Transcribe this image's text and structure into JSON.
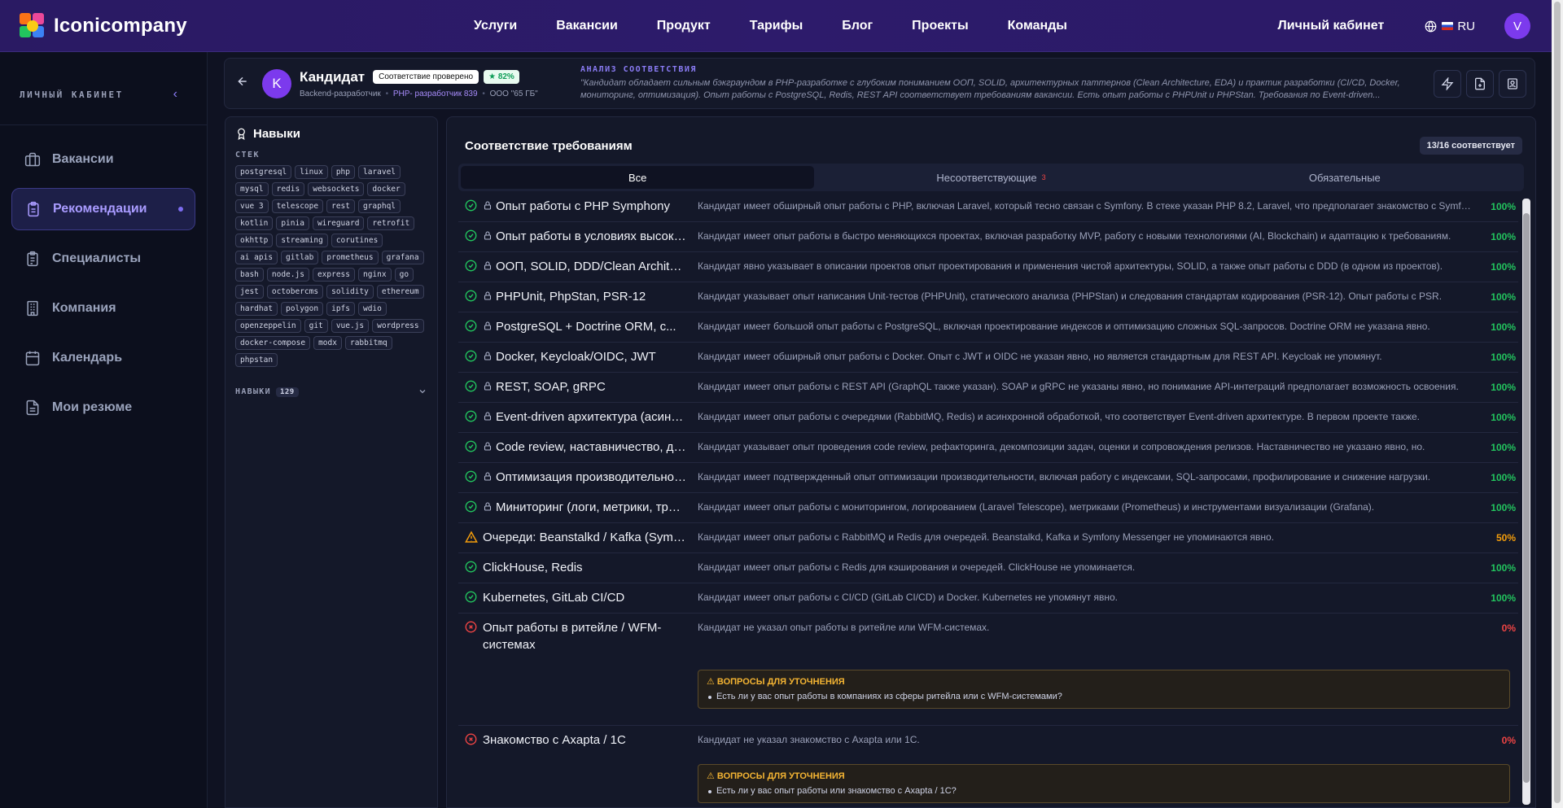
{
  "brand": {
    "name": "Iconicompany"
  },
  "nav": [
    "Услуги",
    "Вакансии",
    "Продукт",
    "Тарифы",
    "Блог",
    "Проекты",
    "Команды"
  ],
  "header": {
    "cabinet": "Личный кабинет",
    "lang": "RU",
    "avatar": "V"
  },
  "sidebar": {
    "title": "ЛИЧНЫЙ КАБИНЕТ",
    "collapse": "‹",
    "items": [
      {
        "label": "Вакансии",
        "icon": "briefcase-icon"
      },
      {
        "label": "Рекомендации",
        "icon": "clipboard-icon"
      },
      {
        "label": "Специалисты",
        "icon": "clipboard-list-icon"
      },
      {
        "label": "Компания",
        "icon": "building-icon"
      },
      {
        "label": "Календарь",
        "icon": "calendar-icon"
      },
      {
        "label": "Мои резюме",
        "icon": "file-icon"
      }
    ]
  },
  "candidate": {
    "avatar": "K",
    "name": "Кандидат",
    "verified": "Соответствие проверено",
    "score": "82%",
    "role": "Backend-разработчик",
    "vacancy": "PHP- разработчик 839",
    "company": "ООО \"65 ГБ\"",
    "analysis_title": "АНАЛИЗ СООТВЕТСТВИЯ",
    "analysis_text": "\"Кандидат обладает сильным бэкграундом в PHP-разработке с глубоким пониманием ООП, SOLID, архитектурных паттернов (Clean Architecture, EDA) и практик разработки (CI/CD, Docker, мониторинг, оптимизация). Опыт работы с PostgreSQL, Redis, REST API соответствует требованиям вакансии. Есть опыт работы с PHPUnit и PHPStan. Требования по Event-driven..."
  },
  "skills": {
    "title": "Навыки",
    "stack_label": "СТЕК",
    "stack": [
      "postgresql",
      "linux",
      "php",
      "laravel",
      "mysql",
      "redis",
      "websockets",
      "docker",
      "vue 3",
      "telescope",
      "rest",
      "graphql",
      "kotlin",
      "pinia",
      "wireguard",
      "retrofit",
      "okhttp",
      "streaming",
      "corutines",
      "ai apis",
      "gitlab",
      "prometheus",
      "grafana",
      "bash",
      "node.js",
      "express",
      "nginx",
      "go",
      "jest",
      "octobercms",
      "solidity",
      "ethereum",
      "hardhat",
      "polygon",
      "ipfs",
      "wdio",
      "openzeppelin",
      "git",
      "vue.js",
      "wordpress",
      "docker-compose",
      "modx",
      "rabbitmq",
      "phpstan"
    ],
    "more_label": "НАВЫКИ",
    "more_count": "129"
  },
  "requirements": {
    "title": "Соответствие требованиям",
    "count": "13/16 соответствует",
    "tabs": [
      {
        "label": "Все"
      },
      {
        "label": "Несоответствующие",
        "badge": "3"
      },
      {
        "label": "Обязательные"
      }
    ],
    "rows": [
      {
        "status": "ok",
        "locked": true,
        "name": "Опыт работы с PHP Symphony",
        "desc": "Кандидат имеет обширный опыт работы с PHP, включая Laravel, который тесно связан с Symfony. В стеке указан PHP 8.2, Laravel, что предполагает знакомство с Symfony.",
        "pct": "100%"
      },
      {
        "status": "ok",
        "locked": true,
        "name": "Опыт работы в условиях высокой неопределенности",
        "desc": "Кандидат имеет опыт работы в быстро меняющихся проектах, включая разработку MVP, работу с новыми технологиями (AI, Blockchain) и адаптацию к требованиям.",
        "pct": "100%"
      },
      {
        "status": "ok",
        "locked": true,
        "name": "ООП, SOLID, DDD/Clean Architecture",
        "desc": "Кандидат явно указывает в описании проектов опыт проектирования и применения чистой архитектуры, SOLID, а также опыт работы с DDD (в одном из проектов).",
        "pct": "100%"
      },
      {
        "status": "ok",
        "locked": true,
        "name": "PHPUnit, PhpStan, PSR-12",
        "desc": "Кандидат указывает опыт написания Unit-тестов (PHPUnit), статического анализа (PHPStan) и следования стандартам кодирования (PSR-12). Опыт работы с PSR.",
        "pct": "100%"
      },
      {
        "status": "ok",
        "locked": true,
        "name": "PostgreSQL + Doctrine ORM, c...",
        "desc": "Кандидат имеет большой опыт работы с PostgreSQL, включая проектирование индексов и оптимизацию сложных SQL-запросов. Doctrine ORM не указана явно.",
        "pct": "100%"
      },
      {
        "status": "ok",
        "locked": true,
        "name": "Docker, Keycloak/OIDC, JWT",
        "desc": "Кандидат имеет обширный опыт работы с Docker. Опыт с JWT и OIDC не указан явно, но является стандартным для REST API. Keycloak не упомянут.",
        "pct": "100%"
      },
      {
        "status": "ok",
        "locked": true,
        "name": "REST, SOAP, gRPC",
        "desc": "Кандидат имеет опыт работы с REST API (GraphQL также указан). SOAP и gRPC не указаны явно, но понимание API-интеграций предполагает возможность освоения.",
        "pct": "100%"
      },
      {
        "status": "ok",
        "locked": true,
        "name": "Event-driven архитектура (асинхронная)",
        "desc": "Кандидат имеет опыт работы с очередями (RabbitMQ, Redis) и асинхронной обработкой, что соответствует Event-driven архитектуре. В первом проекте также.",
        "pct": "100%"
      },
      {
        "status": "ok",
        "locked": true,
        "name": "Code review, наставничество, декомпозиция",
        "desc": "Кандидат указывает опыт проведения code review, рефакторинга, декомпозиции задач, оценки и сопровождения релизов. Наставничество не указано явно, но.",
        "pct": "100%"
      },
      {
        "status": "ok",
        "locked": true,
        "name": "Оптимизация производительности",
        "desc": "Кандидат имеет подтвержденный опыт оптимизации производительности, включая работу с индексами, SQL-запросами, профилирование и снижение нагрузки.",
        "pct": "100%"
      },
      {
        "status": "ok",
        "locked": true,
        "name": "Миниторинг (логи, метрики, трейсинг)",
        "desc": "Кандидат имеет опыт работы с мониторингом, логированием (Laravel Telescope), метриками (Prometheus) и инструментами визуализации (Grafana).",
        "pct": "100%"
      },
      {
        "status": "warn",
        "locked": false,
        "name": "Очереди: Beanstalkd / Kafka (Symfony Messenger)",
        "desc": "Кандидат имеет опыт работы с RabbitMQ и Redis для очередей. Beanstalkd, Kafka и Symfony Messenger не упоминаются явно.",
        "pct": "50%"
      },
      {
        "status": "ok",
        "locked": false,
        "name": "ClickHouse, Redis",
        "desc": "Кандидат имеет опыт работы с Redis для кэширования и очередей. ClickHouse не упоминается.",
        "pct": "100%"
      },
      {
        "status": "ok",
        "locked": false,
        "name": "Kubernetes, GitLab CI/CD",
        "desc": "Кандидат имеет опыт работы с CI/CD (GitLab CI/CD) и Docker. Kubernetes не упомянут явно.",
        "pct": "100%"
      },
      {
        "status": "bad",
        "locked": false,
        "wrap": true,
        "name": "Опыт работы в ритейле / WFM-системах",
        "desc": "Кандидат не указал опыт работы в ритейле или WFM-системах.",
        "pct": "0%",
        "q_title": "⚠ ВОПРОСЫ ДЛЯ УТОЧНЕНИЯ",
        "q_item": "Есть ли у вас опыт работы в компаниях из сферы ритейла или с WFM-системами?"
      },
      {
        "status": "bad",
        "locked": false,
        "name": "Знакомство с Axapta / 1С",
        "desc": "Кандидат не указал знакомство с Axapta или 1С.",
        "pct": "0%",
        "q_title": "⚠ ВОПРОСЫ ДЛЯ УТОЧНЕНИЯ",
        "q_item": "Есть ли у вас опыт работы или знакомство с Axapta / 1С?"
      }
    ]
  },
  "colors": {
    "accent": "#7c3aed",
    "ok": "#22c55e",
    "warn": "#f59e0b",
    "bad": "#ef4444",
    "topbar": "#2d1b6b"
  }
}
